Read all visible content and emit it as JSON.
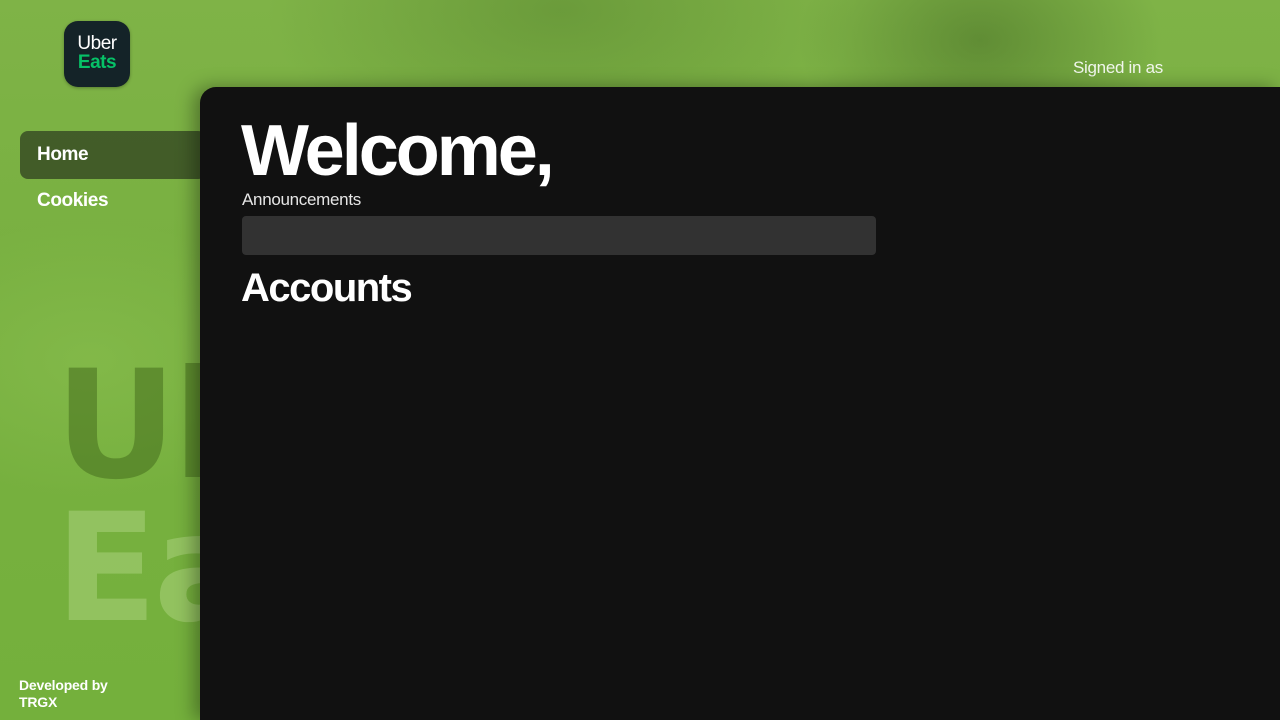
{
  "brand": {
    "logo_line1": "Uber",
    "logo_line2": "Eats",
    "accent_color": "#06c167",
    "background_watermark": [
      "Ub",
      "Ea"
    ]
  },
  "header": {
    "signed_in_text": "Signed in as"
  },
  "sidebar": {
    "items": [
      {
        "label": "Home",
        "active": true
      },
      {
        "label": "Cookies",
        "active": false
      }
    ],
    "credit_line1": "Developed by",
    "credit_line2": "TRGX"
  },
  "main": {
    "welcome": "Welcome,",
    "announcements_label": "Announcements",
    "announcements_text": "",
    "accounts_heading": "Accounts"
  },
  "colors": {
    "panel_bg": "#111111",
    "announcement_box": "#323232",
    "page_bg": "#78b040"
  }
}
